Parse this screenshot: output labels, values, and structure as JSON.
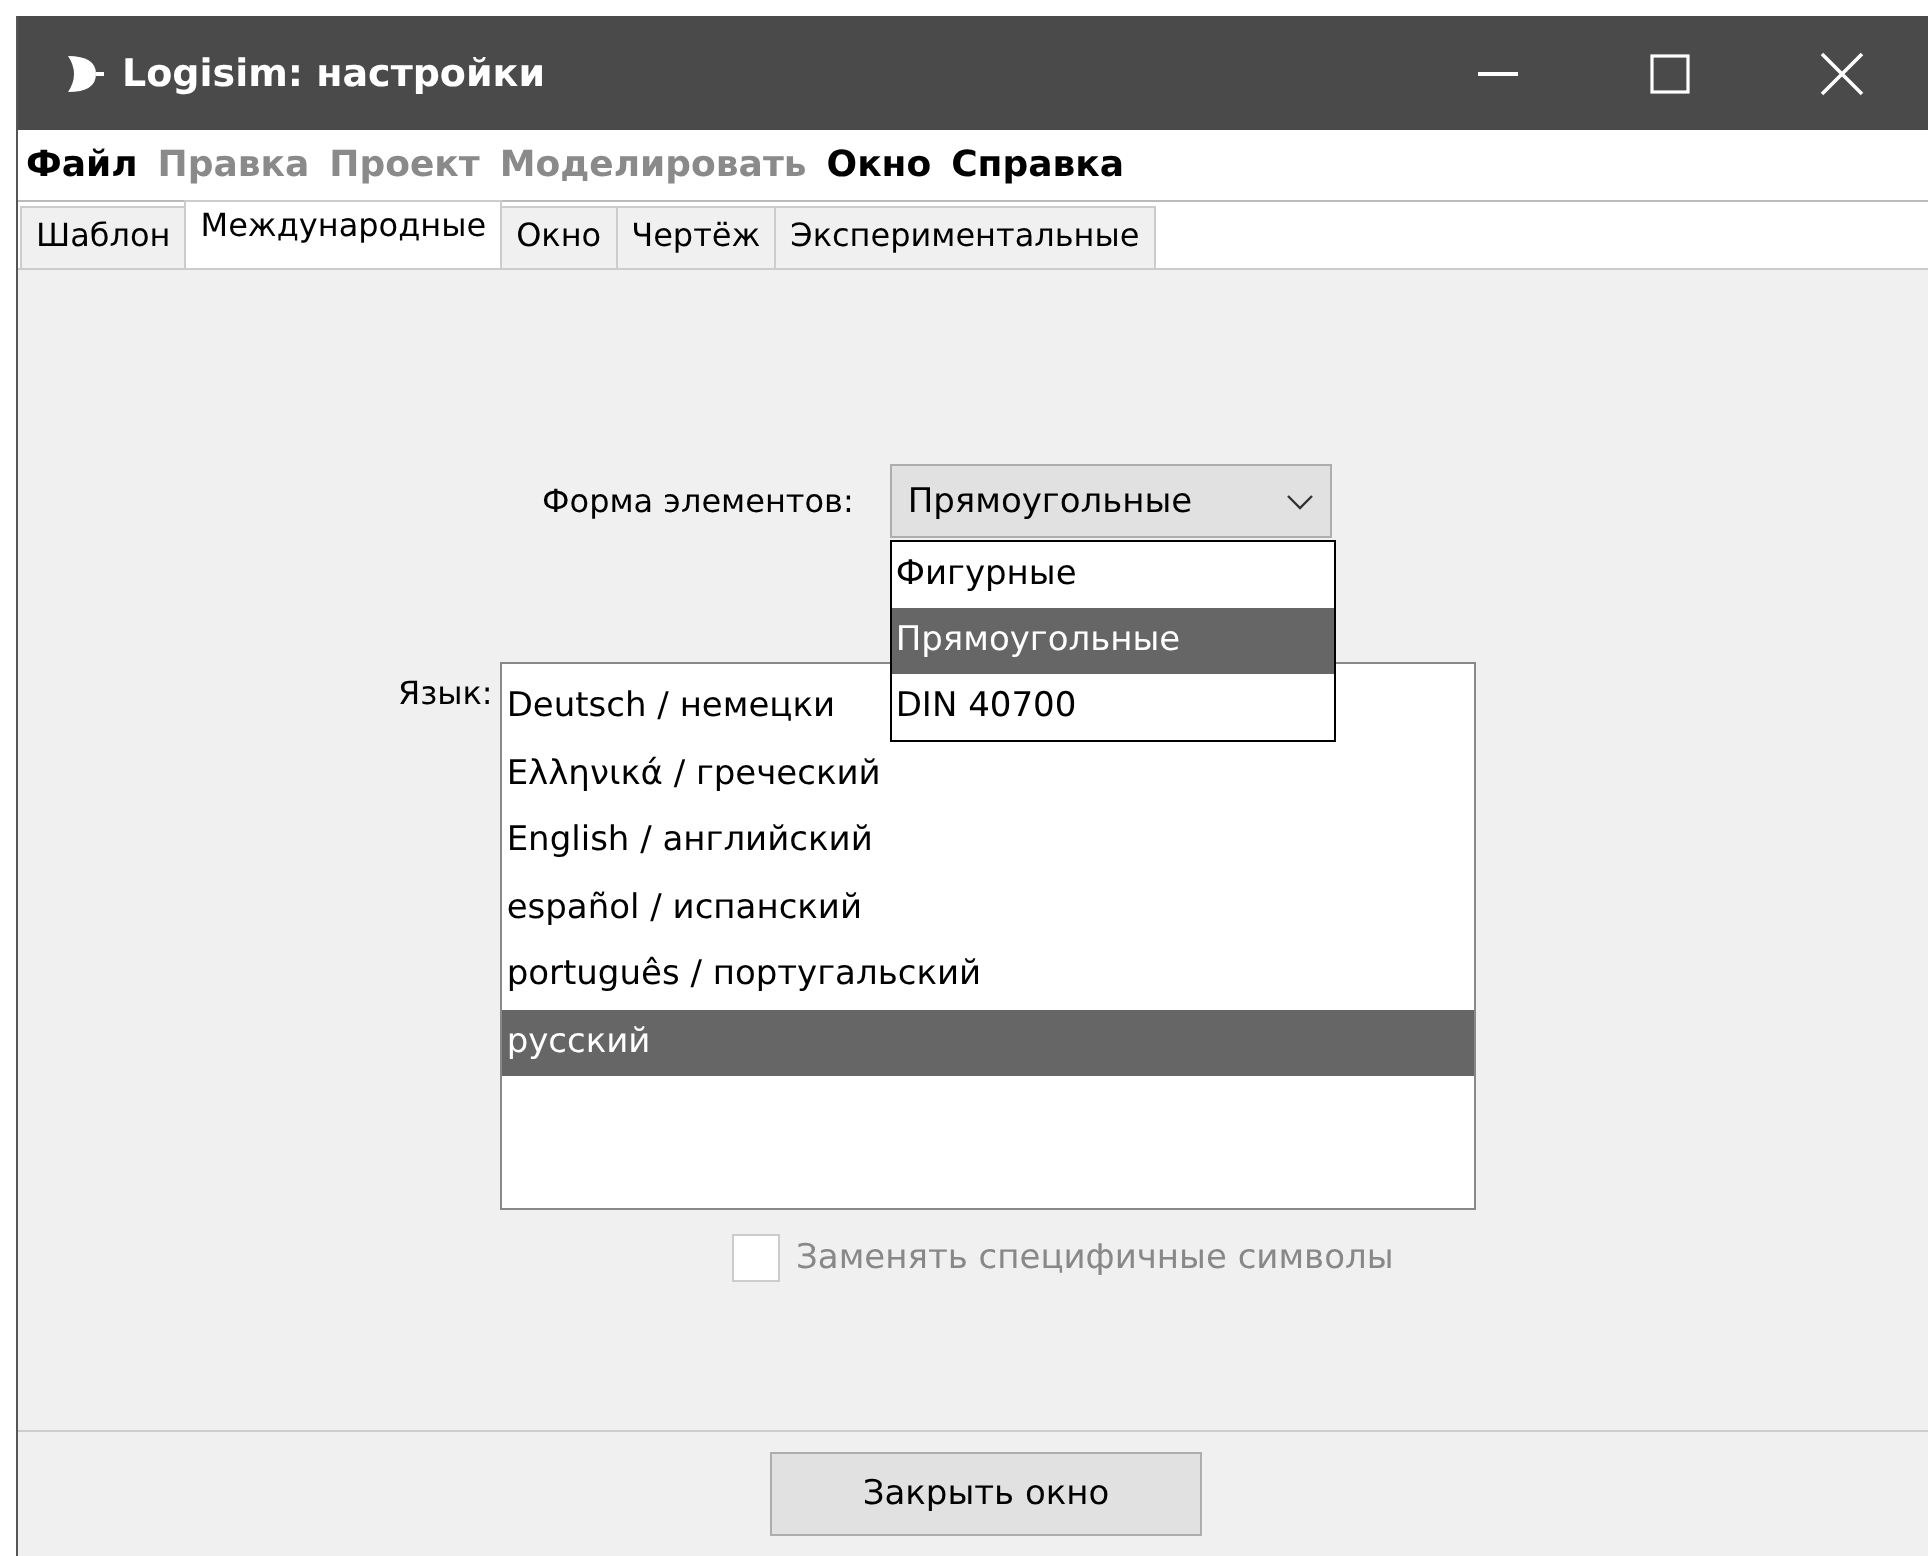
{
  "window": {
    "title": "Logisim: настройки"
  },
  "menu": [
    {
      "label": "Файл",
      "disabled": false
    },
    {
      "label": "Правка",
      "disabled": true
    },
    {
      "label": "Проект",
      "disabled": true
    },
    {
      "label": "Моделировать",
      "disabled": true
    },
    {
      "label": "Окно",
      "disabled": false
    },
    {
      "label": "Справка",
      "disabled": false
    }
  ],
  "tabs": [
    {
      "label": "Шаблон",
      "selected": false
    },
    {
      "label": "Международные",
      "selected": true
    },
    {
      "label": "Окно",
      "selected": false
    },
    {
      "label": "Чертёж",
      "selected": false
    },
    {
      "label": "Экспериментальные",
      "selected": false
    }
  ],
  "gate_shape": {
    "label": "Форма элементов:",
    "value": "Прямоугольные",
    "expanded": true,
    "options": [
      {
        "label": "Фигурные",
        "selected": false
      },
      {
        "label": "Прямоугольные",
        "selected": true
      },
      {
        "label": "DIN 40700",
        "selected": false
      }
    ]
  },
  "language": {
    "label": "Язык:",
    "items": [
      {
        "label": "Deutsch / немецки",
        "selected": false
      },
      {
        "label": "Ελληνικά / греческий",
        "selected": false
      },
      {
        "label": "English / английский",
        "selected": false
      },
      {
        "label": "español / испанский",
        "selected": false
      },
      {
        "label": "português / португальский",
        "selected": false
      },
      {
        "label": "русский",
        "selected": true
      }
    ]
  },
  "replace_chars": {
    "label": "Заменять специфичные символы",
    "checked": false,
    "disabled": true
  },
  "buttons": [
    "Закрыть окно"
  ]
}
